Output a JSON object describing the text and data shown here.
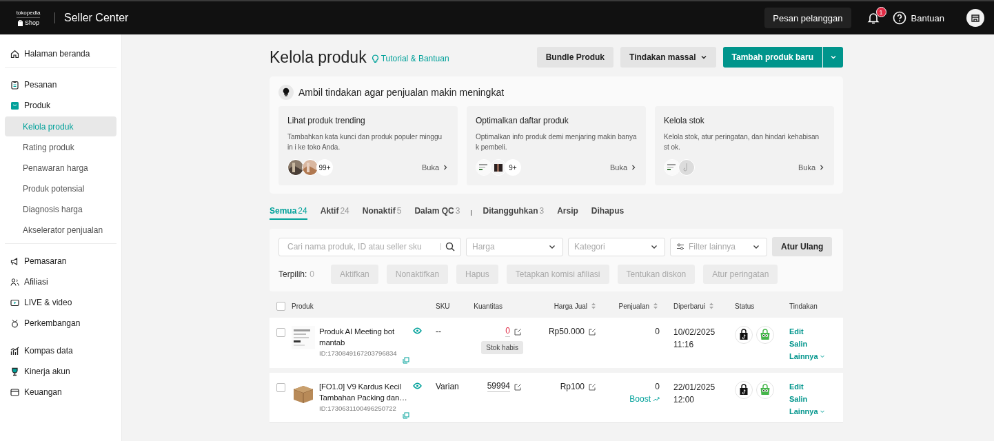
{
  "header": {
    "logo_top": "tokopedia",
    "logo_bottom": "Shop",
    "title": "Seller Center",
    "message_button": "Pesan pelanggan",
    "notification_count": "1",
    "help": "Bantuan"
  },
  "sidebar": {
    "groups": [
      {
        "items": [
          {
            "label": "Halaman beranda"
          }
        ]
      },
      {
        "items": [
          {
            "label": "Pesanan"
          },
          {
            "label": "Produk",
            "children": [
              {
                "label": "Kelola produk",
                "selected": true
              },
              {
                "label": "Rating produk",
                "selected": false
              },
              {
                "label": "Penawaran harga",
                "selected": false
              },
              {
                "label": "Produk potensial",
                "selected": false
              },
              {
                "label": "Diagnosis harga",
                "selected": false
              },
              {
                "label": "Akselerator penjualan",
                "selected": false
              }
            ]
          }
        ]
      },
      {
        "items": [
          {
            "label": "Pemasaran"
          },
          {
            "label": "Afiliasi"
          },
          {
            "label": "LIVE & video"
          },
          {
            "label": "Perkembangan"
          }
        ]
      },
      {
        "items": [
          {
            "label": "Kompas data"
          },
          {
            "label": "Kinerja akun"
          },
          {
            "label": "Keuangan"
          }
        ]
      }
    ]
  },
  "page": {
    "title": "Kelola produk",
    "help_link": "Tutorial & Bantuan",
    "buttons": [
      "Bundle Produk",
      "Tindakan massal"
    ],
    "primary_button": "Tambah produk baru"
  },
  "recommendations": {
    "title": "Ambil tindakan agar penjualan makin meningkat",
    "cards": [
      {
        "title": "Lihat produk trending",
        "description": "Tambahkan kata kunci dan produk populer minggu in i ke toko Anda.",
        "count": "99+",
        "link": "Buka"
      },
      {
        "title": "Optimalkan daftar produk",
        "description": "Optimalkan info produk demi menjaring makin banya k pembeli.",
        "count": "9+",
        "link": "Buka"
      },
      {
        "title": "Kelola stok",
        "description": "Kelola stok, atur peringatan, dan hindari kehabisan st ok.",
        "link": "Buka"
      }
    ]
  },
  "tabs": [
    {
      "label": "Semua",
      "count": "24",
      "selected": true
    },
    {
      "label": "Aktif",
      "count": "24",
      "selected": false
    },
    {
      "label": "Nonaktif",
      "count": "5",
      "selected": false
    },
    {
      "label": "Dalam QC",
      "count": "3",
      "selected": false
    },
    {
      "label": "Ditangguhkan",
      "count": "3",
      "selected": false
    },
    {
      "label": "Arsip",
      "selected": false
    },
    {
      "label": "Dihapus",
      "selected": false
    }
  ],
  "filters": {
    "search_placeholder": "Cari nama produk, ID atau seller sku",
    "dropdowns": [
      "Harga",
      "Kategori",
      "Filter lainnya"
    ],
    "reset": "Atur Ulang",
    "selected_label": "Terpilih:",
    "selected_count": "0",
    "bulk_actions": [
      {
        "label": "Aktifkan",
        "disabled": true
      },
      {
        "label": "Nonaktifkan",
        "disabled": true
      },
      {
        "label": "Hapus",
        "disabled": true
      },
      {
        "label": "Tetapkan komisi afiliasi",
        "disabled": true
      },
      {
        "label": "Tentukan diskon",
        "disabled": true
      },
      {
        "label": "Atur peringatan",
        "disabled": true
      }
    ]
  },
  "table": {
    "select_all": {
      "checked": false
    },
    "columns": [
      {
        "label": "Produk",
        "sortable": false
      },
      {
        "label": "SKU",
        "sortable": false
      },
      {
        "label": "Kuantitas",
        "sortable": false
      },
      {
        "label": "Harga Jual",
        "sortable": true
      },
      {
        "label": "Penjualan",
        "sortable": true
      },
      {
        "label": "Diperbarui",
        "sortable": true
      },
      {
        "label": "Status",
        "sortable": false
      },
      {
        "label": "Tindakan",
        "sortable": false
      }
    ],
    "rows": [
      {
        "checked": false,
        "name": "Produk AI Meeting bot mantab",
        "id": "ID:1730849167203796834",
        "sku": "--",
        "quantity": "0",
        "out_of_stock": true,
        "stock_badge": "Stok habis",
        "price": "Rp50.000",
        "sales": "0",
        "date": "10/02/2025",
        "time": "11:16",
        "actions": [
          "Edit",
          "Salin",
          "Lainnya"
        ]
      },
      {
        "checked": false,
        "name": "[FO1.0] V9 Kardus Kecil Tambahan Packing dan…",
        "id": "ID:1730631100496250722",
        "sku": "Varian",
        "quantity": "59994",
        "out_of_stock": false,
        "price": "Rp100",
        "sales": "0",
        "boost": "Boost",
        "date": "22/01/2025",
        "time": "12:00",
        "actions": [
          "Edit",
          "Salin",
          "Lainnya"
        ]
      }
    ]
  }
}
